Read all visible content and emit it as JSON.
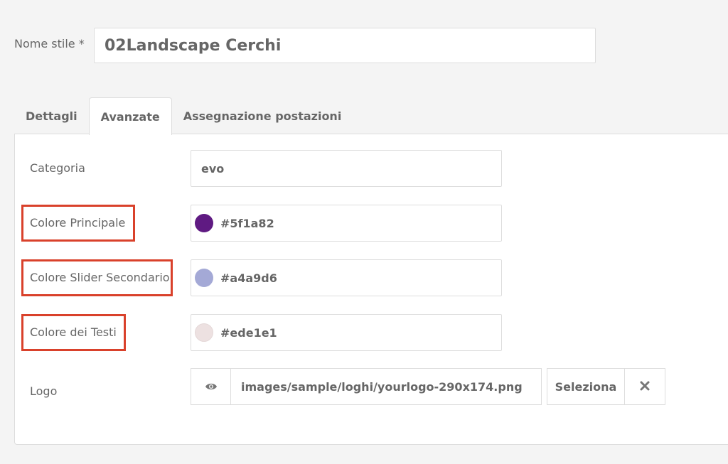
{
  "style_name": {
    "label": "Nome stile *",
    "value": "02Landscape Cerchi"
  },
  "tabs": [
    {
      "label": "Dettagli",
      "active": false
    },
    {
      "label": "Avanzate",
      "active": true
    },
    {
      "label": "Assegnazione postazioni",
      "active": false
    }
  ],
  "fields": {
    "categoria": {
      "label": "Categoria",
      "value": "evo"
    },
    "colore_principale": {
      "label": "Colore Principale",
      "value": "#5f1a82",
      "swatch_color": "#5f1a82"
    },
    "colore_slider": {
      "label": "Colore Slider Secondario",
      "value": "#a4a9d6",
      "swatch_color": "#a4a9d6"
    },
    "colore_testi": {
      "label": "Colore dei Testi",
      "value": "#ede1e1",
      "swatch_color": "#ede1e1"
    },
    "logo": {
      "label": "Logo",
      "value": "images/sample/loghi/yourlogo-290x174.png",
      "select_label": "Seleziona",
      "preview_icon": "eye-icon",
      "clear_icon": "close-icon"
    }
  },
  "highlight_color": "#d9412b"
}
